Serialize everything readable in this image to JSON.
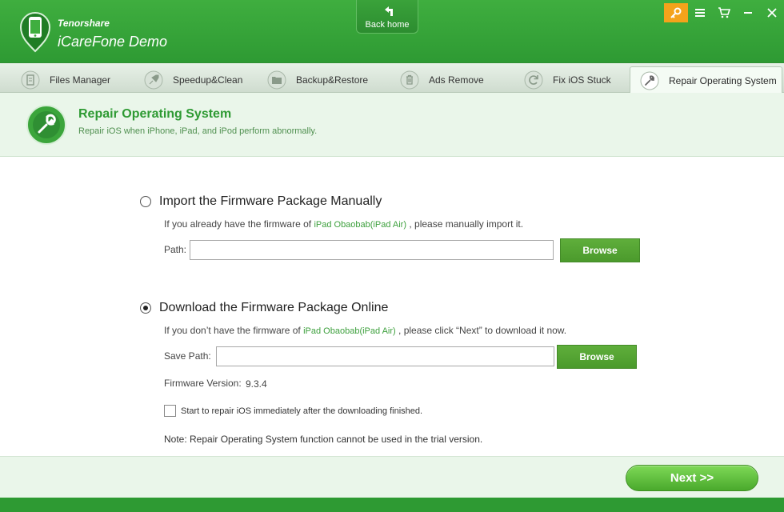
{
  "app": {
    "brand_small": "Tenorshare",
    "brand_title": "iCareFone Demo",
    "back_home_label": "Back home"
  },
  "tabs": [
    {
      "label": "Files Manager",
      "icon": "document-icon"
    },
    {
      "label": "Speedup&Clean",
      "icon": "rocket-icon"
    },
    {
      "label": "Backup&Restore",
      "icon": "folder-icon"
    },
    {
      "label": "Ads Remove",
      "icon": "trash-icon"
    },
    {
      "label": "Fix iOS Stuck",
      "icon": "refresh-icon"
    },
    {
      "label": "Repair Operating System",
      "icon": "wrench-icon",
      "active": true
    }
  ],
  "header": {
    "title": "Repair Operating System",
    "subtitle": "Repair iOS when iPhone, iPad, and iPod perform abnormally."
  },
  "option_manual": {
    "title": "Import the Firmware Package Manually",
    "desc_prefix": "If you already have the firmware of",
    "device": "iPad Obaobab(iPad Air)",
    "desc_suffix": ", please manually import it.",
    "path_label": "Path:",
    "path_value": "",
    "browse_label": "Browse",
    "selected": false
  },
  "option_online": {
    "title": "Download the Firmware Package Online",
    "desc_prefix": "If you don’t have the firmware of",
    "device": "iPad Obaobab(iPad Air)",
    "desc_suffix": ", please click “Next” to download it now.",
    "save_path_label": "Save Path:",
    "save_path_value": "",
    "browse_label": "Browse",
    "firmware_version_label": "Firmware Version:",
    "firmware_version": "9.3.4",
    "checkbox_label": "Start to repair iOS immediately after the downloading finished.",
    "checkbox_checked": false,
    "selected": true
  },
  "note": "Note: Repair Operating System function cannot be used in the trial version.",
  "footer": {
    "next_label": "Next >>"
  },
  "colors": {
    "brand_green": "#2e9a33",
    "accent_green": "#3ea03e",
    "key_orange": "#f4a31b"
  }
}
